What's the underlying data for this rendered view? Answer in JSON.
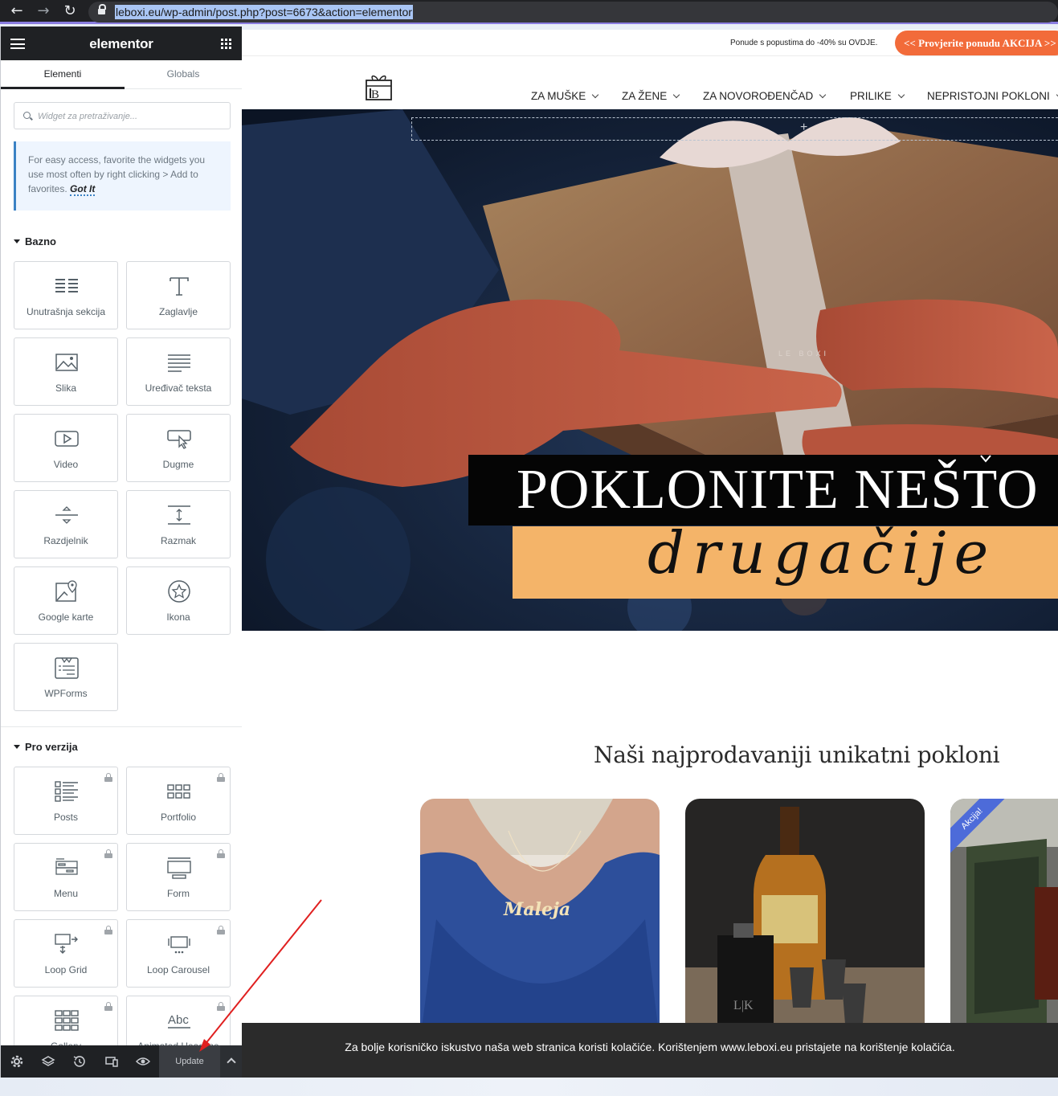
{
  "browser": {
    "url": "leboxi.eu/wp-admin/post.php?post=6673&action=elementor"
  },
  "panel": {
    "logo": "elementor",
    "tabs": [
      "Elementi",
      "Globals"
    ],
    "search_placeholder": "Widget za pretraživanje...",
    "notice_text": "For easy access, favorite the widgets you use most often by right clicking > Add to favorites.",
    "notice_link": "Got It",
    "sections": {
      "basic": {
        "title": "Bazno",
        "widgets": [
          {
            "label": "Unutrašnja sekcija",
            "icon": "inner-section-icon"
          },
          {
            "label": "Zaglavlje",
            "icon": "heading-icon"
          },
          {
            "label": "Slika",
            "icon": "image-icon"
          },
          {
            "label": "Uređivač teksta",
            "icon": "text-editor-icon"
          },
          {
            "label": "Video",
            "icon": "video-icon"
          },
          {
            "label": "Dugme",
            "icon": "button-icon"
          },
          {
            "label": "Razdjelnik",
            "icon": "divider-icon"
          },
          {
            "label": "Razmak",
            "icon": "spacer-icon"
          },
          {
            "label": "Google karte",
            "icon": "google-maps-icon"
          },
          {
            "label": "Ikona",
            "icon": "star-icon"
          },
          {
            "label": "WPForms",
            "icon": "wpforms-icon"
          }
        ]
      },
      "pro": {
        "title": "Pro verzija",
        "widgets": [
          {
            "label": "Posts",
            "icon": "posts-icon"
          },
          {
            "label": "Portfolio",
            "icon": "portfolio-icon"
          },
          {
            "label": "Menu",
            "icon": "menu-icon"
          },
          {
            "label": "Form",
            "icon": "form-icon"
          },
          {
            "label": "Loop Grid",
            "icon": "loop-grid-icon"
          },
          {
            "label": "Loop Carousel",
            "icon": "loop-carousel-icon"
          },
          {
            "label": "Gallery",
            "icon": "gallery-icon"
          },
          {
            "label": "Animated Headline",
            "icon": "animated-headline-icon"
          }
        ]
      }
    },
    "footer": {
      "update_label": "Update",
      "icons": [
        "settings-icon",
        "layers-icon",
        "history-icon",
        "responsive-icon",
        "preview-eye-icon"
      ]
    }
  },
  "site": {
    "promo_text": "Ponude s popustima do -40% su OVDJE.",
    "promo_button": "<< Provjerite ponudu AKCIJA >>",
    "menu": [
      "ZA MUŠKE",
      "ZA ŽENE",
      "ZA NOVOROĐENČAD",
      "PRILIKE",
      "NEPRISTOJNI POKLONI"
    ],
    "hero_title": "POKLONITE NEŠTO",
    "hero_subtitle": "drugačije",
    "hero_gift_logo": "LE BOXI",
    "section_heading": "Naši najprodavaniji unikatni pokloni",
    "products": [
      {
        "name": "necklace",
        "engraving": "Maleja"
      },
      {
        "name": "whisky-flask-set",
        "engraving": "L|K"
      },
      {
        "name": "jerrycan-gift",
        "badge": "Akcija!"
      }
    ],
    "cookie_text": "Za bolje korisničko iskustvo naša web stranica koristi kolačiće. Korištenjem www.leboxi.eu pristajete na korištenje kolačića."
  },
  "colors": {
    "promo_button": "#f26b3a",
    "panel_dark": "#1f2124",
    "hero_band": "#f4b469",
    "badge": "#4d6bd9",
    "annotation_arrow": "#e02020"
  }
}
